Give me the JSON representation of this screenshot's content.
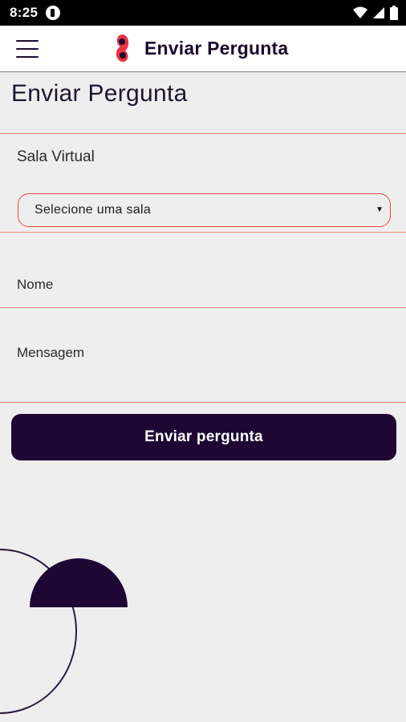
{
  "status_bar": {
    "time": "8:25",
    "icons": [
      "app-notification-icon",
      "wifi-icon",
      "signal-icon",
      "battery-icon"
    ]
  },
  "app_bar": {
    "title": "Enviar Pergunta",
    "menu_icon": "hamburger-menu-icon",
    "logo_icon": "brand-logo-icon"
  },
  "page": {
    "title": "Enviar Pergunta"
  },
  "form": {
    "sala_label": "Sala Virtual",
    "sala_select_value": "Selecione uma sala",
    "nome_label": "Nome",
    "mensagem_label": "Mensagem",
    "submit_label": "Enviar pergunta"
  },
  "colors": {
    "primary_dark": "#1e0833",
    "accent_red": "#e34a3c",
    "divider": "#f08a6b",
    "background": "#efeeee"
  }
}
